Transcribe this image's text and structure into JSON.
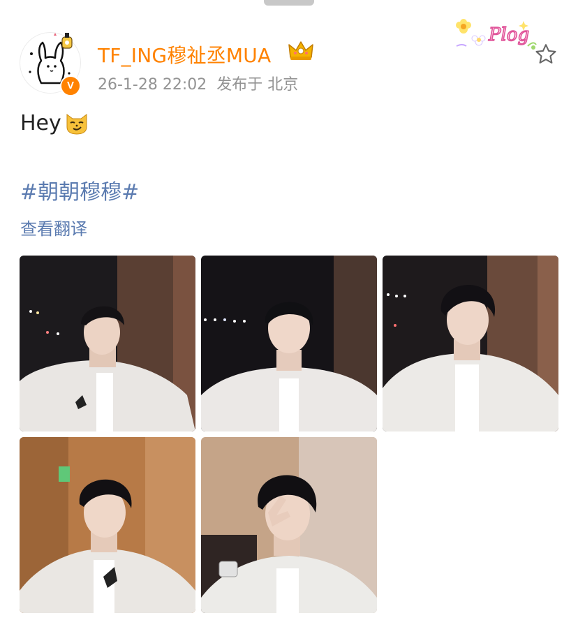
{
  "post": {
    "user": {
      "name": "TF_ING穆祉丞MUA",
      "verified_badge": "V",
      "avatar_icon": "cartoon-rabbit-avatar"
    },
    "meta": {
      "time": "26-1-28 22:02",
      "location": "发布于 北京"
    },
    "sticker_text": "Plog",
    "text": "Hey",
    "hashtag": "#朝朝穆穆#",
    "translate_label": "查看翻译",
    "photos": [
      {
        "alt": "photo-1"
      },
      {
        "alt": "photo-2"
      },
      {
        "alt": "photo-3"
      },
      {
        "alt": "photo-4"
      },
      {
        "alt": "photo-5"
      }
    ]
  },
  "colors": {
    "username": "#ff8200",
    "link": "#5b7bb0",
    "meta": "#939393",
    "text": "#222222"
  }
}
